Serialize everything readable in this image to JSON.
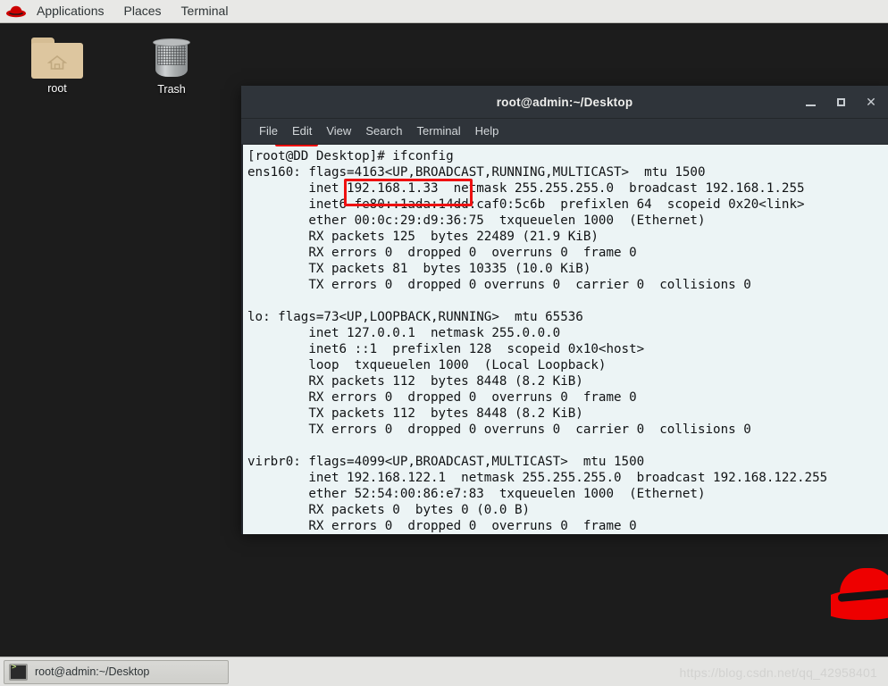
{
  "panel": {
    "logo_icon": "redhat-fedora-icon",
    "menus": [
      {
        "label": "Applications",
        "name": "applications-menu"
      },
      {
        "label": "Places",
        "name": "places-menu"
      },
      {
        "label": "Terminal",
        "name": "terminal-menu"
      }
    ]
  },
  "desktop": {
    "icons": [
      {
        "label": "root",
        "icon": "home-folder-icon",
        "name": "desktop-icon-root"
      },
      {
        "label": "Trash",
        "icon": "trash-can-icon",
        "name": "desktop-icon-trash"
      }
    ],
    "wallpaper_logo": "redhat-fedora-logo"
  },
  "terminal_window": {
    "title": "root@admin:~/Desktop",
    "window_controls": {
      "minimize": "_",
      "maximize": "□",
      "close": "✕"
    },
    "menubar": [
      {
        "label": "File",
        "name": "menu-file"
      },
      {
        "label": "Edit",
        "name": "menu-edit"
      },
      {
        "label": "View",
        "name": "menu-view"
      },
      {
        "label": "Search",
        "name": "menu-search"
      },
      {
        "label": "Terminal",
        "name": "menu-terminal"
      },
      {
        "label": "Help",
        "name": "menu-help"
      }
    ],
    "lines": [
      "[root@DD Desktop]# ifconfig",
      "ens160: flags=4163<UP,BROADCAST,RUNNING,MULTICAST>  mtu 1500",
      "        inet 192.168.1.33  netmask 255.255.255.0  broadcast 192.168.1.255",
      "        inet6 fe80::1ada:14dd:caf0:5c6b  prefixlen 64  scopeid 0x20<link>",
      "        ether 00:0c:29:d9:36:75  txqueuelen 1000  (Ethernet)",
      "        RX packets 125  bytes 22489 (21.9 KiB)",
      "        RX errors 0  dropped 0  overruns 0  frame 0",
      "        TX packets 81  bytes 10335 (10.0 KiB)",
      "        TX errors 0  dropped 0 overruns 0  carrier 0  collisions 0",
      "",
      "lo: flags=73<UP,LOOPBACK,RUNNING>  mtu 65536",
      "        inet 127.0.0.1  netmask 255.0.0.0",
      "        inet6 ::1  prefixlen 128  scopeid 0x10<host>",
      "        loop  txqueuelen 1000  (Local Loopback)",
      "        RX packets 112  bytes 8448 (8.2 KiB)",
      "        RX errors 0  dropped 0  overruns 0  frame 0",
      "        TX packets 112  bytes 8448 (8.2 KiB)",
      "        TX errors 0  dropped 0 overruns 0  carrier 0  collisions 0",
      "",
      "virbr0: flags=4099<UP,BROADCAST,MULTICAST>  mtu 1500",
      "        inet 192.168.122.1  netmask 255.255.255.0  broadcast 192.168.122.255",
      "        ether 52:54:00:86:e7:83  txqueuelen 1000  (Ethernet)",
      "        RX packets 0  bytes 0 (0.0 B)",
      "        RX errors 0  dropped 0  overruns 0  frame 0"
    ],
    "annotations": [
      {
        "name": "annotation-hostname-box",
        "target": "DD"
      },
      {
        "name": "annotation-ip-address-box",
        "target": "192.168.1.33"
      }
    ],
    "annotation_color": "#ee1111"
  },
  "taskbar": {
    "window_button_label": "root@admin:~/Desktop",
    "window_button_icon": "terminal-icon"
  },
  "watermark": "https://blog.csdn.net/qq_42958401",
  "colors": {
    "desktop_bg": "#1c1c1c",
    "panel_bg": "#e8e8e6",
    "terminal_chrome": "#2f343a",
    "terminal_bg": "#ecf4f5",
    "terminal_fg": "#111315",
    "redhat_red": "#ee0000",
    "annotation_red": "#ee1111"
  }
}
